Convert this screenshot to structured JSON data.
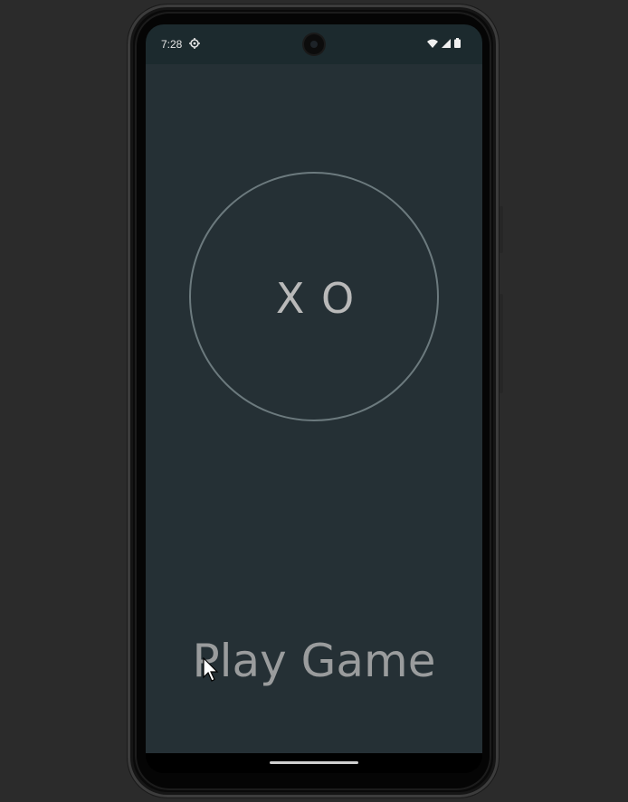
{
  "status_bar": {
    "time": "7:28",
    "settings_icon": "gear-icon",
    "wifi_icon": "wifi-icon",
    "signal_icon": "cell-signal-icon",
    "battery_icon": "battery-icon"
  },
  "app": {
    "logo_text": "X O",
    "play_button_label": "Play Game",
    "background_color": "#253035",
    "circle_color": "#6c7a7e",
    "text_color": "#9a9c9d"
  },
  "pointer": {
    "icon": "mouse-pointer-icon"
  }
}
